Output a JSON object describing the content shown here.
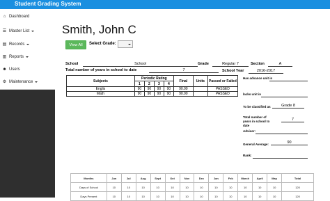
{
  "app": {
    "title": "Student Grading System"
  },
  "sidebar": {
    "items": [
      {
        "label": "Dashboard",
        "icon": "dashboard-icon",
        "glyph": "⌂",
        "caret": false
      },
      {
        "label": "Master List",
        "icon": "list-icon",
        "glyph": "☰",
        "caret": true
      },
      {
        "label": "Records",
        "icon": "folder-icon",
        "glyph": "▤",
        "caret": true
      },
      {
        "label": "Reports",
        "icon": "report-icon",
        "glyph": "▥",
        "caret": true
      },
      {
        "label": "Users",
        "icon": "users-icon",
        "glyph": "👥",
        "caret": false
      },
      {
        "label": "Maintenance",
        "icon": "wrench-icon",
        "glyph": "⚙",
        "caret": true
      }
    ]
  },
  "page": {
    "student_name": "Smith, John C"
  },
  "toolbar": {
    "view_all_label": "View All",
    "select_grade_label": "Select Grade:",
    "select_grade_value": ""
  },
  "info": {
    "school_label": "School",
    "school_value": "School",
    "grade_label": "Grade",
    "grade_value": "Regular 7",
    "section_label": "Section",
    "section_value": "A",
    "years_label": "Total number of years in school to date",
    "years_value": "7",
    "school_year_label": "School Year",
    "school_year_value": "2016-2017"
  },
  "grades_table": {
    "subjects_header": "Subjects",
    "periodic_header": "Periodic Rating",
    "periods": [
      "1",
      "2",
      "3",
      "4"
    ],
    "final_header": "Final",
    "units_header": "Units",
    "passed_header": "Passed or Failed",
    "rows": [
      {
        "subject": "Englis",
        "p1": "90",
        "p2": "90",
        "p3": "90",
        "p4": "90",
        "final": "90.00",
        "units": "",
        "remark": "PASSED"
      },
      {
        "subject": "Math",
        "p1": "90",
        "p2": "90",
        "p3": "90",
        "p4": "90",
        "final": "90.00",
        "units": "",
        "remark": "PASSED"
      }
    ]
  },
  "right_panel": {
    "advance_label": "Has advance unit in",
    "lacks_label": "lacks unit in",
    "classified_label": "To be classified as",
    "classified_value": "Grade 8",
    "total_years_label": "Total number of years in school to date",
    "total_years_value": "7",
    "adviser_label": "Adviser:",
    "average_label": "General Average:",
    "average_value": "90",
    "rank_label": "Rank:"
  },
  "attendance": {
    "headers": [
      "Months",
      "Jun",
      "Jul",
      "Aug",
      "Sept",
      "Oct",
      "Nov",
      "Dec",
      "Jan",
      "Feb",
      "March",
      "April",
      "May",
      "Total"
    ],
    "rows": [
      [
        "Days of School",
        "10",
        "10",
        "10",
        "10",
        "10",
        "10",
        "10",
        "10",
        "10",
        "10",
        "10",
        "10",
        "120"
      ],
      [
        "Days Present",
        "10",
        "10",
        "10",
        "10",
        "10",
        "10",
        "10",
        "10",
        "10",
        "10",
        "10",
        "10",
        "120"
      ]
    ]
  }
}
